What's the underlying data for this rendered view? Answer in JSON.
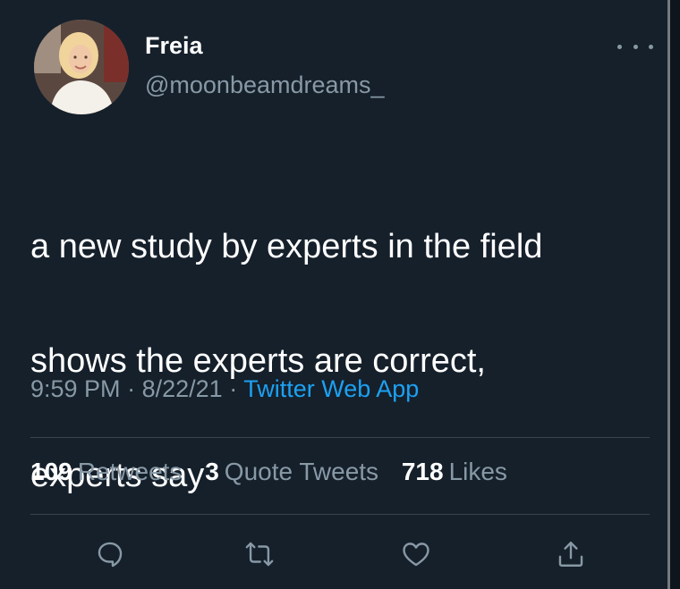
{
  "author": {
    "name": "Freia",
    "handle": "@moonbeamdreams_",
    "avatar_icon": "profile-photo"
  },
  "tweet": {
    "text_lines": [
      "a new study by experts in the field",
      "shows the experts are correct,",
      "experts say"
    ],
    "time": "9:59 PM",
    "date": "8/22/21",
    "separator": "·",
    "source": "Twitter Web App"
  },
  "stats": {
    "retweets_count": "109",
    "retweets_label": "Retweets",
    "quotes_count": "3",
    "quotes_label": "Quote Tweets",
    "likes_count": "718",
    "likes_label": "Likes"
  },
  "actions": [
    "reply-icon",
    "retweet-icon",
    "like-icon",
    "share-icon"
  ],
  "colors": {
    "background": "#15202b",
    "text": "#ffffff",
    "secondary": "#8899a6",
    "accent": "#1da1f2",
    "divider": "#38444d"
  }
}
